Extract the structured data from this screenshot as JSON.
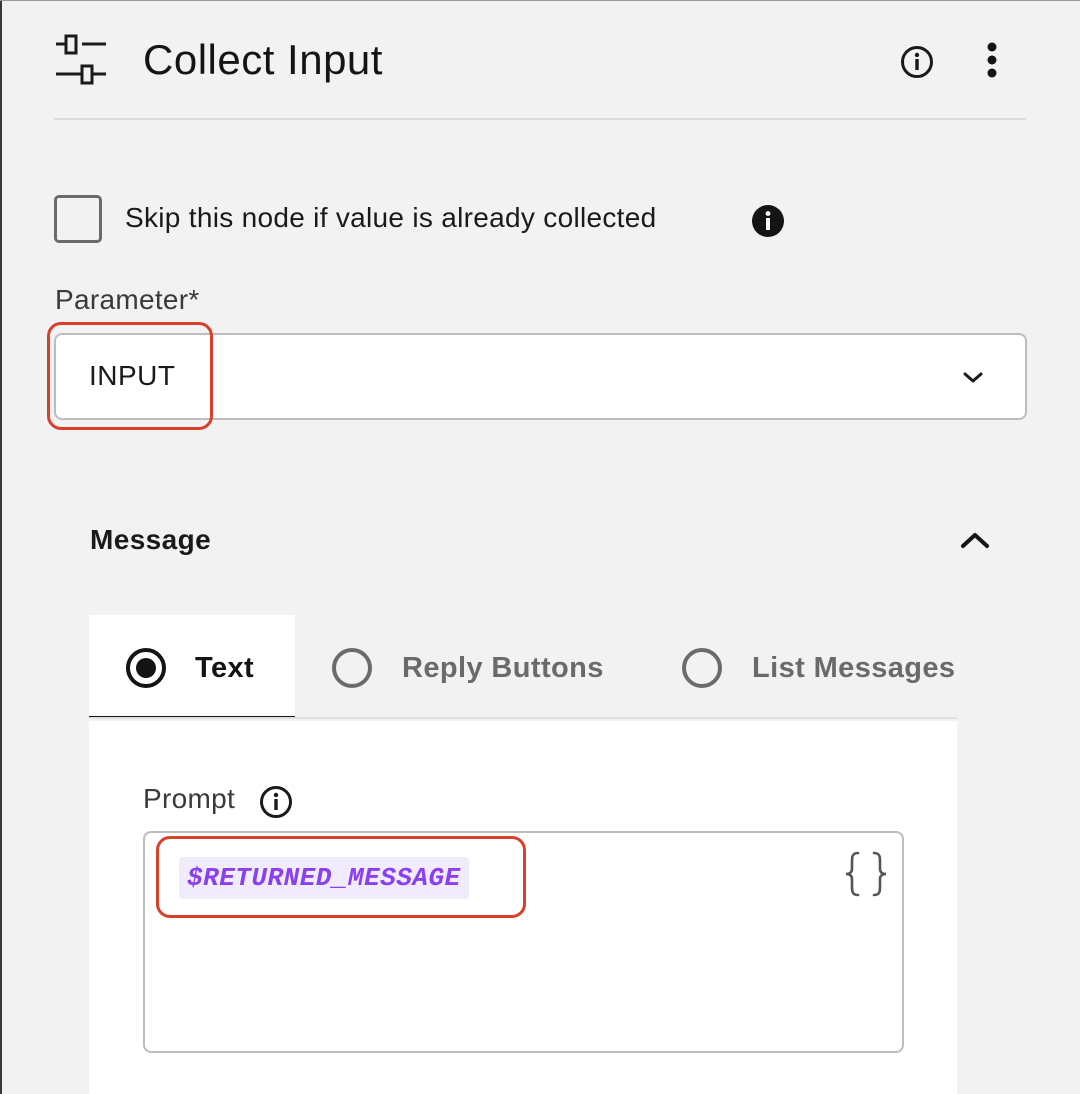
{
  "header": {
    "title": "Collect Input",
    "node_icon": "collect-input-icon",
    "info_icon": "info-circle-icon",
    "more_icon": "more-vertical-icon"
  },
  "skip": {
    "label": "Skip this node if value is already collected",
    "checked": false,
    "info_icon": "info-filled-icon"
  },
  "parameter": {
    "label": "Parameter*",
    "value": "INPUT",
    "chevron_icon": "chevron-down-icon"
  },
  "message": {
    "title": "Message",
    "toggle_icon": "chevron-up-icon",
    "tabs": [
      {
        "label": "Text",
        "selected": true
      },
      {
        "label": "Reply Buttons",
        "selected": false
      },
      {
        "label": "List Messages",
        "selected": false
      }
    ],
    "prompt": {
      "label": "Prompt",
      "value": "$RETURNED_MESSAGE",
      "variable_icon": "curly-braces-icon"
    }
  },
  "colors": {
    "highlight": "#d9402c",
    "token_text": "#8a3ff0",
    "token_bg": "#f1ecfb",
    "background": "#f2f2f2"
  }
}
